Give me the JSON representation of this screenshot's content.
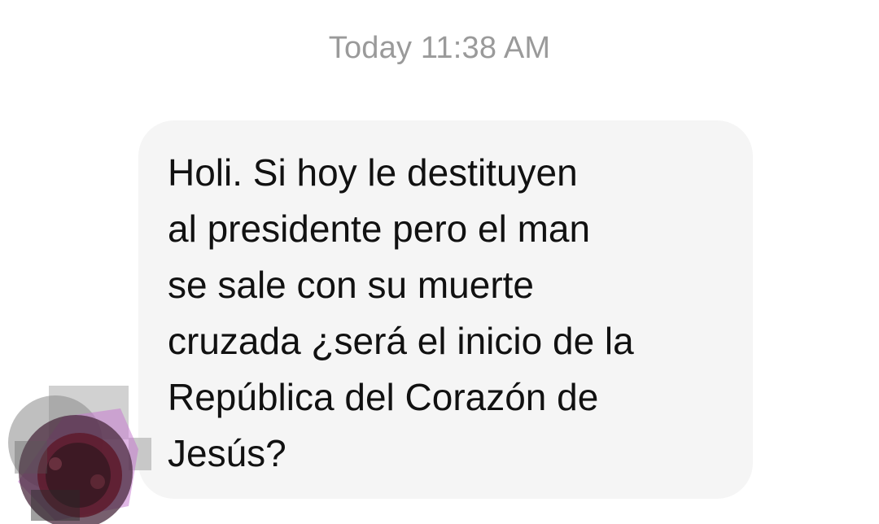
{
  "conversation": {
    "timestamp": "Today 11:38 AM",
    "messages": [
      {
        "direction": "incoming",
        "text": "Holi. Si hoy le destituyen\nal presidente pero el man\nse sale con su muerte\ncruzada ¿será el inicio de la\nRepública del Corazón de\nJesús?"
      }
    ]
  },
  "colors": {
    "background": "#ffffff",
    "bubble": "#f5f5f5",
    "timestamp_text": "#9a9a9a",
    "message_text": "#111111"
  },
  "icons": {
    "avatar": "sender-avatar-redacted"
  }
}
